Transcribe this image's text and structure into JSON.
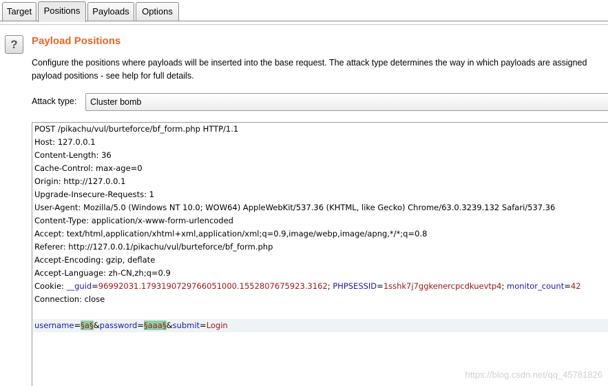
{
  "tabs": [
    {
      "label": "Target"
    },
    {
      "label": "Positions"
    },
    {
      "label": "Payloads"
    },
    {
      "label": "Options"
    }
  ],
  "active_tab": "Positions",
  "section": {
    "title": "Payload Positions",
    "help_icon": "?",
    "description_line1": "Configure the positions where payloads will be inserted into the base request. The attack type determines the way in which payloads are assigned",
    "description_line2": "payload positions - see help for full details."
  },
  "attack_type": {
    "label": "Attack type:",
    "value": "Cluster bomb"
  },
  "request": {
    "headers": [
      "POST /pikachu/vul/burteforce/bf_form.php HTTP/1.1",
      "Host: 127.0.0.1",
      "Content-Length: 36",
      "Cache-Control: max-age=0",
      "Origin: http://127.0.0.1",
      "Upgrade-Insecure-Requests: 1",
      "User-Agent: Mozilla/5.0 (Windows NT 10.0; WOW64) AppleWebKit/537.36 (KHTML, like Gecko) Chrome/63.0.3239.132 Safari/537.36",
      "Content-Type: application/x-www-form-urlencoded",
      "Accept: text/html,application/xhtml+xml,application/xml;q=0.9,image/webp,image/apng,*/*;q=0.8",
      "Referer: http://127.0.0.1/pikachu/vul/burteforce/bf_form.php",
      "Accept-Encoding: gzip, deflate",
      "Accept-Language: zh-CN,zh;q=0.9"
    ],
    "cookie": {
      "prefix": "Cookie: ",
      "guid_name": "__guid",
      "guid_value": "96992031.1793190729766051000.1552807675923.3162",
      "sess_name": "PHPSESSID",
      "sess_value": "1sshk7j7ggkenercpcdkuevtp4",
      "mc_name": "monitor_count",
      "mc_value": "42"
    },
    "connection": "Connection: close",
    "body": {
      "user_name": "username",
      "user_pos": "§a§",
      "pass_name": "password",
      "pass_pos": "§aaa§",
      "submit_name": "submit",
      "submit_value": "Login"
    }
  },
  "watermark": "https://blog.csdn.net/qq_45781826"
}
